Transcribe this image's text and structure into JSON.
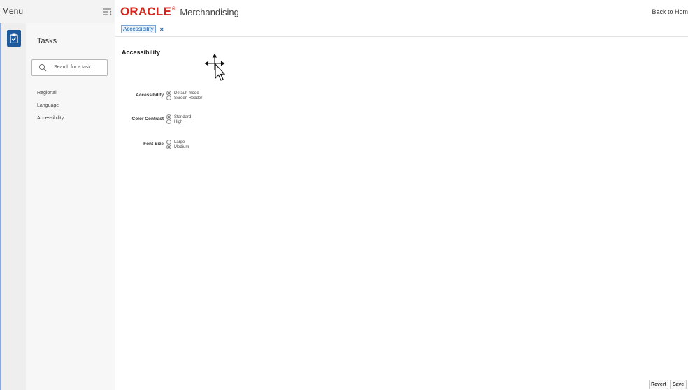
{
  "header": {
    "menu_label": "Menu",
    "brand_logo": "ORACLE",
    "brand_mark": "®",
    "app_name": "Merchandising",
    "back_home": "Back to Hom"
  },
  "tabs": [
    {
      "label": "Accessibility",
      "close": "×"
    }
  ],
  "taskpanel": {
    "title": "Tasks",
    "search_placeholder": "Search for a task",
    "items": [
      "Regional",
      "Language",
      "Accessibility"
    ]
  },
  "page": {
    "title": "Accessibility",
    "fields": [
      {
        "label": "Accessibility",
        "options": [
          "Default mode",
          "Screen Reader"
        ],
        "selected": "Default mode"
      },
      {
        "label": "Color Contrast",
        "options": [
          "Standard",
          "High"
        ],
        "selected": "Standard"
      },
      {
        "label": "Font Size",
        "options": [
          "Large",
          "Medium"
        ],
        "selected": "Medium"
      }
    ]
  },
  "footer": {
    "revert_label": "Revert",
    "save_label": "Save"
  },
  "icons": {
    "collapse": "collapse-menu-icon",
    "tasks": "clipboard-check-icon",
    "search": "search-icon",
    "cursor": "move-cursor-icon"
  },
  "colors": {
    "oracle_red": "#d4241c",
    "rail_accent": "#1d5a9e",
    "tab_link": "#1f5fa3"
  }
}
